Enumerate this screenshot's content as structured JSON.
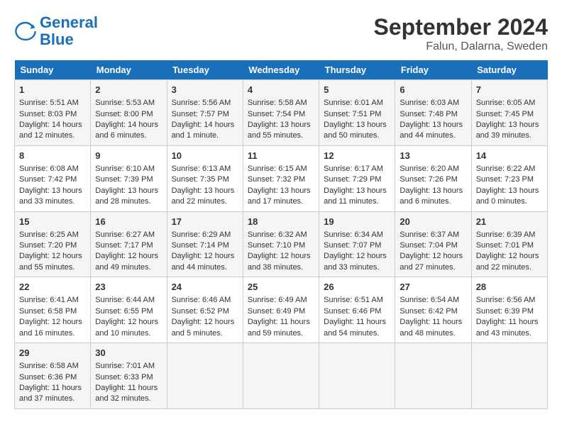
{
  "header": {
    "logo_line1": "General",
    "logo_line2": "Blue",
    "month": "September 2024",
    "location": "Falun, Dalarna, Sweden"
  },
  "days_of_week": [
    "Sunday",
    "Monday",
    "Tuesday",
    "Wednesday",
    "Thursday",
    "Friday",
    "Saturday"
  ],
  "weeks": [
    [
      {
        "day": 1,
        "lines": [
          "Sunrise: 5:51 AM",
          "Sunset: 8:03 PM",
          "Daylight: 14 hours",
          "and 12 minutes."
        ]
      },
      {
        "day": 2,
        "lines": [
          "Sunrise: 5:53 AM",
          "Sunset: 8:00 PM",
          "Daylight: 14 hours",
          "and 6 minutes."
        ]
      },
      {
        "day": 3,
        "lines": [
          "Sunrise: 5:56 AM",
          "Sunset: 7:57 PM",
          "Daylight: 14 hours",
          "and 1 minute."
        ]
      },
      {
        "day": 4,
        "lines": [
          "Sunrise: 5:58 AM",
          "Sunset: 7:54 PM",
          "Daylight: 13 hours",
          "and 55 minutes."
        ]
      },
      {
        "day": 5,
        "lines": [
          "Sunrise: 6:01 AM",
          "Sunset: 7:51 PM",
          "Daylight: 13 hours",
          "and 50 minutes."
        ]
      },
      {
        "day": 6,
        "lines": [
          "Sunrise: 6:03 AM",
          "Sunset: 7:48 PM",
          "Daylight: 13 hours",
          "and 44 minutes."
        ]
      },
      {
        "day": 7,
        "lines": [
          "Sunrise: 6:05 AM",
          "Sunset: 7:45 PM",
          "Daylight: 13 hours",
          "and 39 minutes."
        ]
      }
    ],
    [
      {
        "day": 8,
        "lines": [
          "Sunrise: 6:08 AM",
          "Sunset: 7:42 PM",
          "Daylight: 13 hours",
          "and 33 minutes."
        ]
      },
      {
        "day": 9,
        "lines": [
          "Sunrise: 6:10 AM",
          "Sunset: 7:39 PM",
          "Daylight: 13 hours",
          "and 28 minutes."
        ]
      },
      {
        "day": 10,
        "lines": [
          "Sunrise: 6:13 AM",
          "Sunset: 7:35 PM",
          "Daylight: 13 hours",
          "and 22 minutes."
        ]
      },
      {
        "day": 11,
        "lines": [
          "Sunrise: 6:15 AM",
          "Sunset: 7:32 PM",
          "Daylight: 13 hours",
          "and 17 minutes."
        ]
      },
      {
        "day": 12,
        "lines": [
          "Sunrise: 6:17 AM",
          "Sunset: 7:29 PM",
          "Daylight: 13 hours",
          "and 11 minutes."
        ]
      },
      {
        "day": 13,
        "lines": [
          "Sunrise: 6:20 AM",
          "Sunset: 7:26 PM",
          "Daylight: 13 hours",
          "and 6 minutes."
        ]
      },
      {
        "day": 14,
        "lines": [
          "Sunrise: 6:22 AM",
          "Sunset: 7:23 PM",
          "Daylight: 13 hours",
          "and 0 minutes."
        ]
      }
    ],
    [
      {
        "day": 15,
        "lines": [
          "Sunrise: 6:25 AM",
          "Sunset: 7:20 PM",
          "Daylight: 12 hours",
          "and 55 minutes."
        ]
      },
      {
        "day": 16,
        "lines": [
          "Sunrise: 6:27 AM",
          "Sunset: 7:17 PM",
          "Daylight: 12 hours",
          "and 49 minutes."
        ]
      },
      {
        "day": 17,
        "lines": [
          "Sunrise: 6:29 AM",
          "Sunset: 7:14 PM",
          "Daylight: 12 hours",
          "and 44 minutes."
        ]
      },
      {
        "day": 18,
        "lines": [
          "Sunrise: 6:32 AM",
          "Sunset: 7:10 PM",
          "Daylight: 12 hours",
          "and 38 minutes."
        ]
      },
      {
        "day": 19,
        "lines": [
          "Sunrise: 6:34 AM",
          "Sunset: 7:07 PM",
          "Daylight: 12 hours",
          "and 33 minutes."
        ]
      },
      {
        "day": 20,
        "lines": [
          "Sunrise: 6:37 AM",
          "Sunset: 7:04 PM",
          "Daylight: 12 hours",
          "and 27 minutes."
        ]
      },
      {
        "day": 21,
        "lines": [
          "Sunrise: 6:39 AM",
          "Sunset: 7:01 PM",
          "Daylight: 12 hours",
          "and 22 minutes."
        ]
      }
    ],
    [
      {
        "day": 22,
        "lines": [
          "Sunrise: 6:41 AM",
          "Sunset: 6:58 PM",
          "Daylight: 12 hours",
          "and 16 minutes."
        ]
      },
      {
        "day": 23,
        "lines": [
          "Sunrise: 6:44 AM",
          "Sunset: 6:55 PM",
          "Daylight: 12 hours",
          "and 10 minutes."
        ]
      },
      {
        "day": 24,
        "lines": [
          "Sunrise: 6:46 AM",
          "Sunset: 6:52 PM",
          "Daylight: 12 hours",
          "and 5 minutes."
        ]
      },
      {
        "day": 25,
        "lines": [
          "Sunrise: 6:49 AM",
          "Sunset: 6:49 PM",
          "Daylight: 11 hours",
          "and 59 minutes."
        ]
      },
      {
        "day": 26,
        "lines": [
          "Sunrise: 6:51 AM",
          "Sunset: 6:46 PM",
          "Daylight: 11 hours",
          "and 54 minutes."
        ]
      },
      {
        "day": 27,
        "lines": [
          "Sunrise: 6:54 AM",
          "Sunset: 6:42 PM",
          "Daylight: 11 hours",
          "and 48 minutes."
        ]
      },
      {
        "day": 28,
        "lines": [
          "Sunrise: 6:56 AM",
          "Sunset: 6:39 PM",
          "Daylight: 11 hours",
          "and 43 minutes."
        ]
      }
    ],
    [
      {
        "day": 29,
        "lines": [
          "Sunrise: 6:58 AM",
          "Sunset: 6:36 PM",
          "Daylight: 11 hours",
          "and 37 minutes."
        ]
      },
      {
        "day": 30,
        "lines": [
          "Sunrise: 7:01 AM",
          "Sunset: 6:33 PM",
          "Daylight: 11 hours",
          "and 32 minutes."
        ]
      },
      null,
      null,
      null,
      null,
      null
    ]
  ]
}
